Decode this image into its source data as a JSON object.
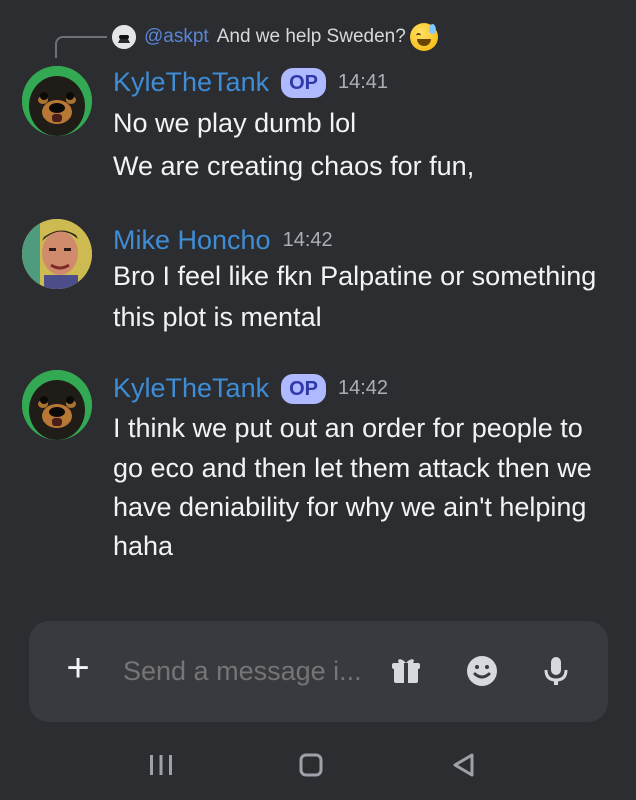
{
  "reply": {
    "author": "@askpt",
    "text": "And we help Sweden?"
  },
  "messages": [
    {
      "author": "KyleTheTank",
      "badge": "OP",
      "time": "14:41",
      "lines": [
        "No we play dumb lol",
        "We are creating chaos for fun,"
      ]
    },
    {
      "author": "Mike Honcho",
      "time": "14:42",
      "lines": [
        "Bro I feel like fkn Palpatine or something",
        "this plot is mental"
      ]
    },
    {
      "author": "KyleTheTank",
      "badge": "OP",
      "time": "14:42",
      "lines": [
        "I think we put out an order for people to",
        "go eco and then let them attack then we",
        "have deniability for why we ain't helping",
        "haha"
      ]
    }
  ],
  "composer": {
    "placeholder": "Send a message i..."
  },
  "colors": {
    "background": "#2b2d31",
    "username": "#3f8dd6",
    "op_badge": "#aeb9ff",
    "composer": "#383a40"
  },
  "icons": [
    "plus-icon",
    "gift-icon",
    "emoji-icon",
    "microphone-icon",
    "recent-apps-icon",
    "home-icon",
    "back-icon"
  ]
}
